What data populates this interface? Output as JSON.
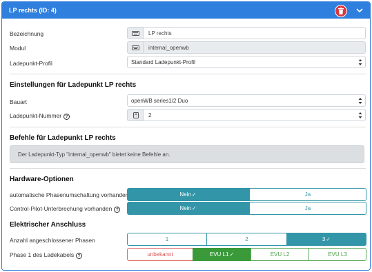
{
  "header": {
    "title": "LP rechts (ID: 4)"
  },
  "general": {
    "bezeichnung": {
      "label": "Bezeichnung",
      "value": "LP rechts"
    },
    "modul": {
      "label": "Modul",
      "value": "internal_openwb"
    },
    "profil": {
      "label": "Ladepunkt-Profil",
      "value": "Standard Ladepunkt-Profil"
    }
  },
  "settings": {
    "title": "Einstellungen für Ladepunkt LP rechts",
    "bauart": {
      "label": "Bauart",
      "value": "openWB series1/2 Duo"
    },
    "nummer": {
      "label": "Ladepunkt-Nummer",
      "value": "2"
    }
  },
  "commands": {
    "title": "Befehle für Ladepunkt LP rechts",
    "message": "Der Ladepunkt-Typ \"internal_openwb\" bietet keine Befehle an."
  },
  "hardware": {
    "title": "Hardware-Optionen",
    "phase_switch": {
      "label": "automatische Phasenumschaltung vorhanden",
      "no": "Nein",
      "yes": "Ja",
      "selected": "Nein"
    },
    "cp_interrupt": {
      "label": "Control-Pilot-Unterbrechung vorhanden",
      "no": "Nein",
      "yes": "Ja",
      "selected": "Nein"
    }
  },
  "electrical": {
    "title": "Elektrischer Anschluss",
    "phases": {
      "label": "Anzahl angeschlossener Phasen",
      "options": [
        "1",
        "2",
        "3"
      ],
      "selected": "3"
    },
    "phase1": {
      "label": "Phase 1 des Ladekabels",
      "options": [
        "unbekannt",
        "EVU L1",
        "EVU L2",
        "EVU L3"
      ],
      "selected": "EVU L1"
    }
  },
  "colors": {
    "header": "#2f7fde",
    "teal": "#3296a8",
    "green": "#3a9a3a",
    "danger": "#d9373f"
  }
}
